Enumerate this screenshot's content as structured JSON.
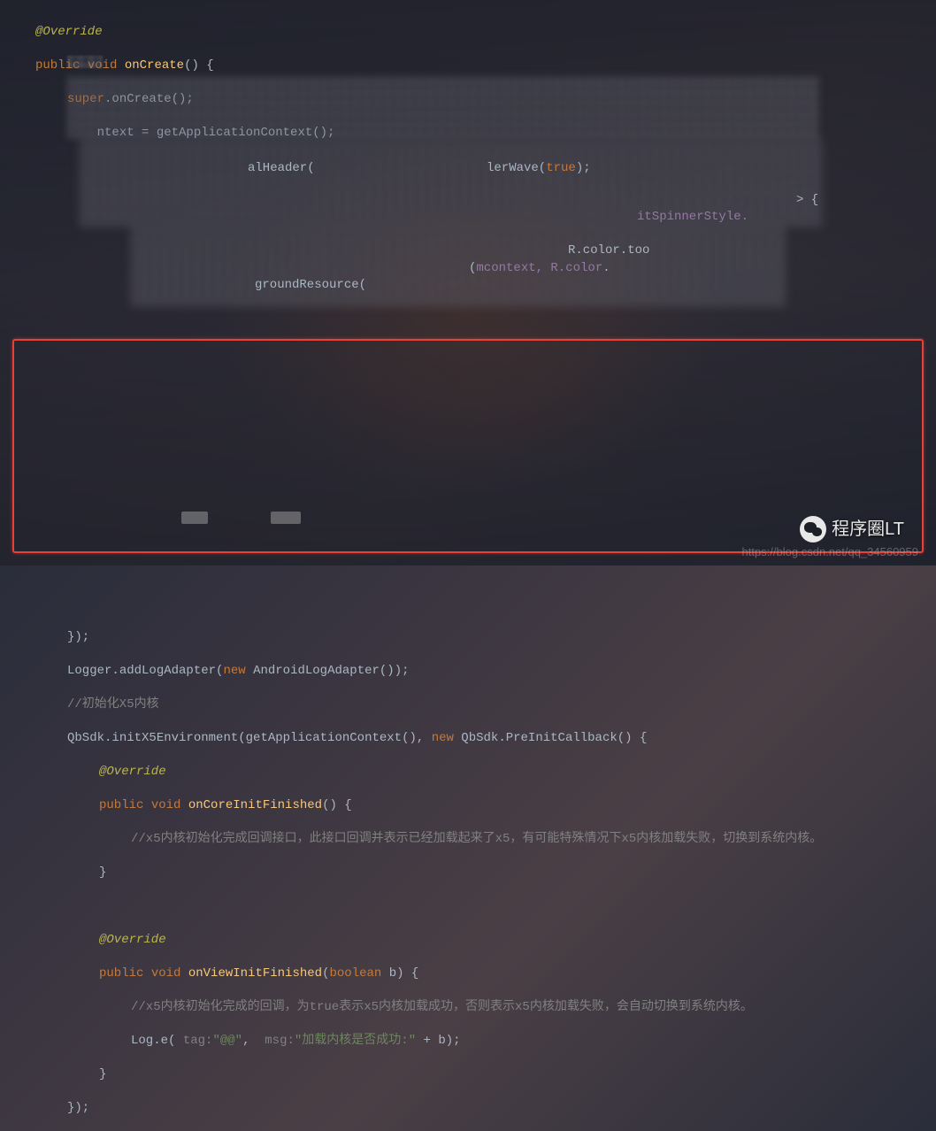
{
  "code": {
    "l1_annotation": "@Override",
    "l2_a": "public",
    "l2_b": "void",
    "l2_c": "onCreate",
    "l2_d": "() {",
    "l3_a": "super",
    "l3_b": ".onCreate();",
    "l4_a": "ntext = getApplicationContext();",
    "frag_header_a": "alHeader(",
    "frag_header_b": "lerWave(",
    "frag_true": "true",
    "frag_header_c": ");",
    "frag_arrow": "> {",
    "frag_spinner": "itSpinnerStyle.",
    "frag_mcontext": "mcontext, R.color",
    "frag_toolbar": "R.color.too",
    "frag_resource": "groundResource(",
    "l18": "});",
    "l19_a": "Logger",
    "l19_b": ".addLogAdapter(",
    "l19_c": "new",
    "l19_d": " AndroidLogAdapter());",
    "l20_comment": "//初始化X5内核",
    "l21_a": "QbSdk",
    "l21_b": ".initX5Environment(getApplicationContext(), ",
    "l21_c": "new",
    "l21_d": " QbSdk",
    "l21_e": ".PreInitCallback() {",
    "l22_annotation": "@Override",
    "l23_a": "public",
    "l23_b": "void",
    "l23_c": "onCoreInitFinished",
    "l23_d": "() {",
    "l24_comment": "//x5内核初始化完成回调接口，此接口回调并表示已经加载起来了x5，有可能特殊情况下x5内核加载失败，切换到系统内核。",
    "l25": "}",
    "l27_annotation": "@Override",
    "l28_a": "public",
    "l28_b": "void",
    "l28_c": "onViewInitFinished",
    "l28_d": "(",
    "l28_e": "boolean",
    "l28_f": " b) {",
    "l29_comment": "//x5内核初始化完成的回调，为true表示x5内核加载成功，否则表示x5内核加载失败，会自动切换到系统内核。",
    "l30_a": "Log",
    "l30_b": ".e(",
    "l30_tag": " tag:",
    "l30_c": "\"@@\"",
    "l30_d": ", ",
    "l30_msg": " msg:",
    "l30_e": "\"加载内核是否成功:\"",
    "l30_f": " + b);",
    "l31": "}",
    "l32": "});"
  },
  "watermark": {
    "url": "https://blog.csdn.net/qq_34560959",
    "brand": "程序圈LT"
  }
}
